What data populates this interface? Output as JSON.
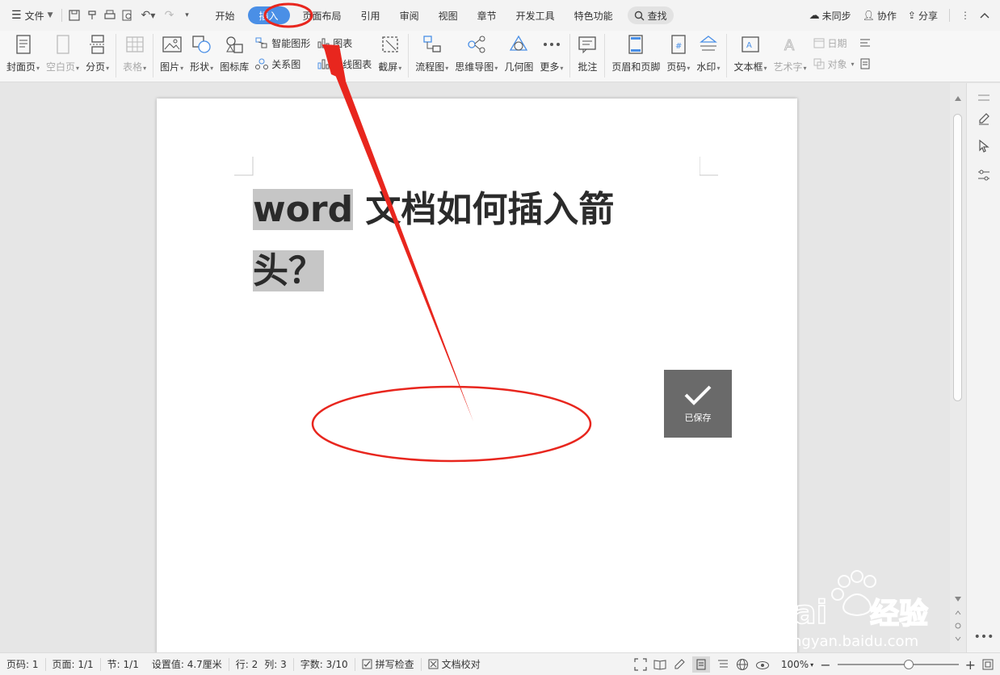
{
  "menubar": {
    "file_label": "文件",
    "tabs": [
      {
        "label": "开始",
        "active": false
      },
      {
        "label": "插入",
        "active": true
      },
      {
        "label": "页面布局",
        "active": false
      },
      {
        "label": "引用",
        "active": false
      },
      {
        "label": "审阅",
        "active": false
      },
      {
        "label": "视图",
        "active": false
      },
      {
        "label": "章节",
        "active": false
      },
      {
        "label": "开发工具",
        "active": false
      },
      {
        "label": "特色功能",
        "active": false
      }
    ],
    "search_label": "查找",
    "sync_label": "未同步",
    "collab_label": "协作",
    "share_label": "分享"
  },
  "ribbon": {
    "cover": "封面页",
    "blank_page": "空白页",
    "page_break": "分页",
    "table": "表格",
    "picture": "图片",
    "shapes": "形状",
    "icon_lib": "图标库",
    "smart_art": "智能图形",
    "relation_map": "关系图",
    "chart": "图表",
    "online_chart": "在线图表",
    "screenshot": "截屏",
    "flowchart": "流程图",
    "mindmap": "思维导图",
    "geometry": "几何图",
    "more": "更多",
    "comment": "批注",
    "header_footer": "页眉和页脚",
    "page_number": "页码",
    "watermark": "水印",
    "textbox": "文本框",
    "art_text": "艺术字",
    "date": "日期",
    "object": "对象"
  },
  "document": {
    "title_line1_selected": "word",
    "title_line1_rest": " 文档如何插入箭",
    "title_line2": "头？"
  },
  "toast": {
    "saved_label": "已保存"
  },
  "statusbar": {
    "page_num": "页码: 1",
    "pages": "页面: 1/1",
    "section": "节: 1/1",
    "setting": "设置值: 4.7厘米",
    "row": "行: 2",
    "col": "列: 3",
    "words": "字数: 3/10",
    "spell_check": "拼写检查",
    "doc_proof": "文档校对",
    "zoom": "100%",
    "zoom_value": 100
  },
  "colors": {
    "accent": "#4a8fe6",
    "annotation": "#e8261e",
    "selection": "#c6c6c6",
    "toast": "#6a6a6a"
  }
}
